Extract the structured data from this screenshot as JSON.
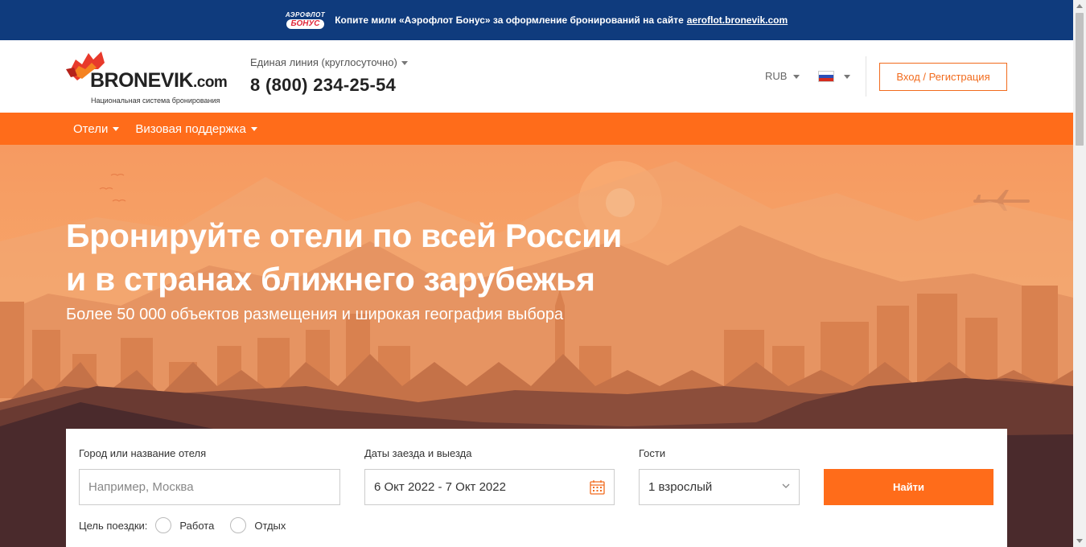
{
  "promo": {
    "logo_top": "АЭРОФЛОТ",
    "logo_bottom": "БОНУС",
    "text": "Копите мили «Аэрофлот Бонус» за оформление бронирований на сайте",
    "link": "aeroflot.bronevik.com"
  },
  "header": {
    "logo_name": "BRONEVIK",
    "logo_domain": ".com",
    "logo_tagline": "Национальная система бронирования",
    "phone_label": "Единая линия (круглосуточно)",
    "phone": "8 (800) 234-25-54",
    "currency": "RUB",
    "language_icon": "russia-flag-icon",
    "login_label": "Вход / Регистрация"
  },
  "nav": {
    "items": [
      {
        "label": "Отели"
      },
      {
        "label": "Визовая поддержка"
      }
    ]
  },
  "hero": {
    "title_line1": "Бронируйте отели по всей России",
    "title_line2": "и в странах ближнего зарубежья",
    "subtitle": "Более 50 000 объектов размещения и широкая география выбора"
  },
  "search": {
    "city_label": "Город или название отеля",
    "city_placeholder": "Например, Москва",
    "dates_label": "Даты заезда и выезда",
    "dates_value": "6 Окт 2022 - 7 Окт 2022",
    "guests_label": "Гости",
    "guests_value": "1 взрослый",
    "find_label": "Найти",
    "purpose_label": "Цель поездки:",
    "purpose_options": [
      "Работа",
      "Отдых"
    ]
  },
  "colors": {
    "accent": "#ff6c1a",
    "promo_bg": "#0f3b7d",
    "hero_sky": "#f69a61"
  }
}
